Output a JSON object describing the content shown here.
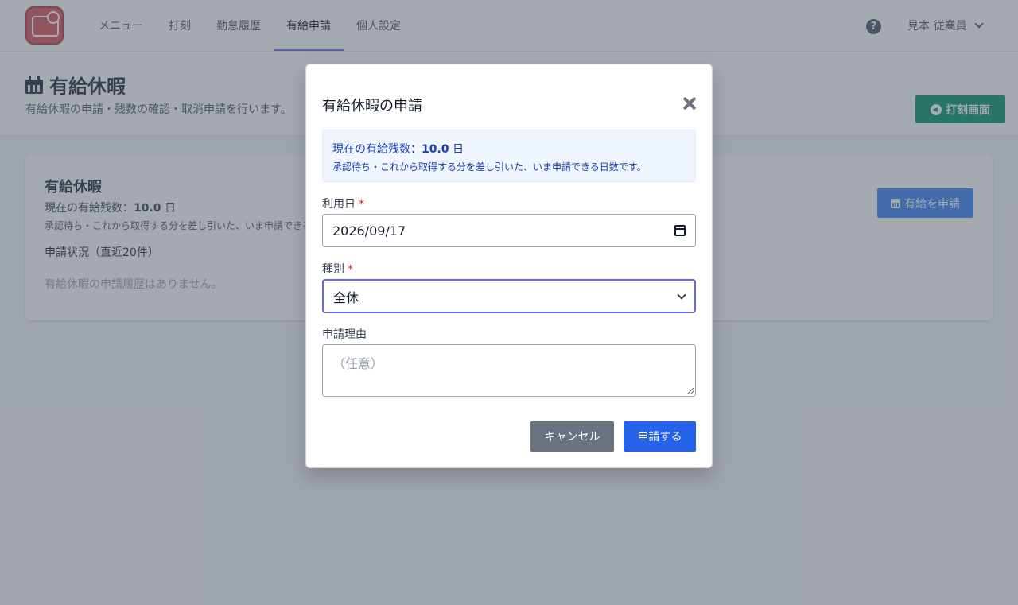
{
  "header": {
    "nav": [
      "メニュー",
      "打刻",
      "勤怠履歴",
      "有給申請",
      "個人設定"
    ],
    "active_nav": "有給申請",
    "user_name": "見本 従業員"
  },
  "page": {
    "title": "有給休暇",
    "subtitle": "有給休暇の申請・残数の確認・取消申請を行います。",
    "punch_button": "打刻画面"
  },
  "card": {
    "title": "有給休暇",
    "balance_label": "現在の有給残数：",
    "balance_value": "10.0",
    "balance_unit": " 日",
    "note": "承認待ち・これから取得する分を差し引いた、いま申請できる日数です。",
    "status_heading": "申請状況（直近20件）",
    "empty_message": "有給休暇の申請履歴はありません。",
    "apply_button": "有給を申請"
  },
  "modal": {
    "title": "有給休暇の申請",
    "info": {
      "label": "現在の有給残数：",
      "value": "10.0",
      "unit": " 日",
      "note": "承認待ち・これから取得する分を差し引いた、いま申請できる日数です。"
    },
    "date_label": "利用日",
    "date_value": "2026/09/17",
    "type_label": "種別",
    "type_value": "全休",
    "reason_label": "申請理由",
    "reason_placeholder": "（任意）",
    "required_mark": "*",
    "cancel_button": "キャンセル",
    "submit_button": "申請する"
  },
  "colors": {
    "accent": "#6366f1",
    "primary": "#2563eb",
    "success": "#059669",
    "info_bg": "#eff6ff",
    "info_text": "#1e40af"
  },
  "icons": [
    "app-logo-icon",
    "question-circle-icon",
    "chevron-down-icon",
    "calendar-icon",
    "circle-arrow-left-icon",
    "close-icon"
  ]
}
